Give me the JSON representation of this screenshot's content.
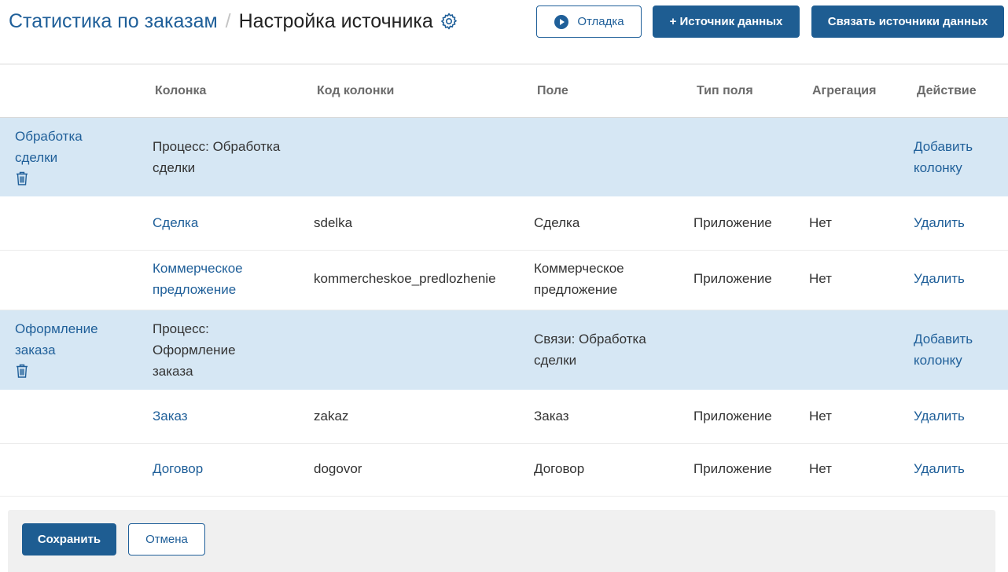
{
  "header": {
    "breadcrumb_parent": "Статистика по заказам",
    "separator": "/",
    "title": "Настройка источника",
    "buttons": {
      "debug": "Отладка",
      "add_source": "+ Источник данных",
      "link_sources": "Связать источники данных"
    }
  },
  "table": {
    "columns": [
      "Колонка",
      "Код колонки",
      "Поле",
      "Тип поля",
      "Агрегация",
      "Действие"
    ],
    "groups": [
      {
        "name": "Обработка сделки",
        "process": "Процесс: Обработка сделки",
        "field": "",
        "action": "Добавить колонку",
        "rows": [
          {
            "column": "Сделка",
            "code": "sdelka",
            "field": "Сделка",
            "type": "Приложение",
            "aggregation": "Нет",
            "action": "Удалить"
          },
          {
            "column": "Коммерческое предложение",
            "code": "kommercheskoe_predlozhenie",
            "field": "Коммерческое предложение",
            "type": "Приложение",
            "aggregation": "Нет",
            "action": "Удалить"
          }
        ]
      },
      {
        "name": "Оформление заказа",
        "process": "Процесс: Оформление заказа",
        "field": "Связи: Обработка сделки",
        "action": "Добавить колонку",
        "rows": [
          {
            "column": "Заказ",
            "code": "zakaz",
            "field": "Заказ",
            "type": "Приложение",
            "aggregation": "Нет",
            "action": "Удалить"
          },
          {
            "column": "Договор",
            "code": "dogovor",
            "field": "Договор",
            "type": "Приложение",
            "aggregation": "Нет",
            "action": "Удалить"
          }
        ]
      }
    ]
  },
  "footer": {
    "save": "Сохранить",
    "cancel": "Отмена"
  },
  "colors": {
    "accent": "#1e5d92",
    "group_row_bg": "#d6e7f4",
    "footer_bg": "#f0f0f0"
  },
  "icons": {
    "settings": "gear-icon",
    "debug": "play-icon",
    "delete_group": "trash-icon"
  }
}
